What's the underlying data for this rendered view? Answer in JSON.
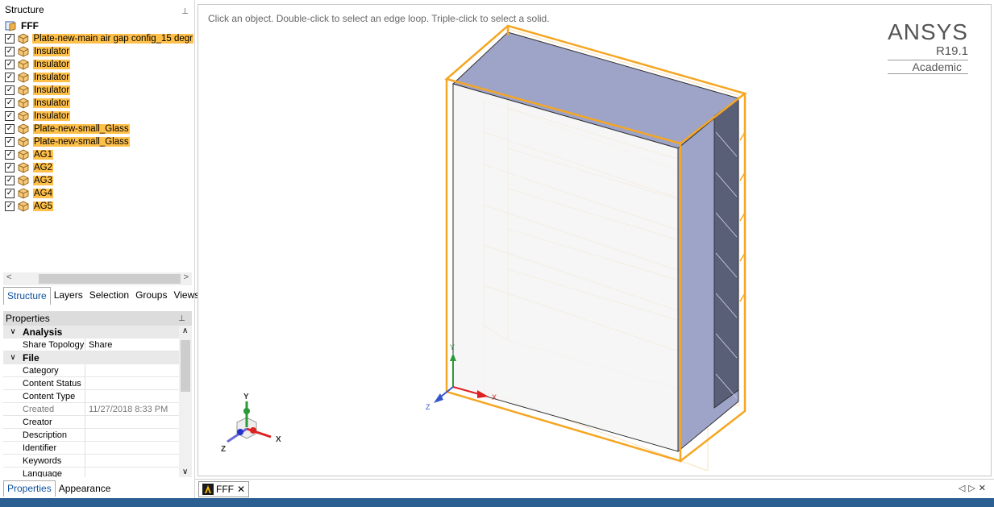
{
  "structure_panel": {
    "title": "Structure",
    "root": "FFF",
    "items": [
      {
        "label": "Plate-new-main air gap config_15 degr",
        "checked": true
      },
      {
        "label": "Insulator",
        "checked": true
      },
      {
        "label": "Insulator",
        "checked": true
      },
      {
        "label": "Insulator",
        "checked": true
      },
      {
        "label": "Insulator",
        "checked": true
      },
      {
        "label": "Insulator",
        "checked": true
      },
      {
        "label": "Insulator",
        "checked": true
      },
      {
        "label": "Plate-new-small_Glass",
        "checked": true
      },
      {
        "label": "Plate-new-small_Glass",
        "checked": true
      },
      {
        "label": "AG1",
        "checked": true
      },
      {
        "label": "AG2",
        "checked": true
      },
      {
        "label": "AG3",
        "checked": true
      },
      {
        "label": "AG4",
        "checked": true
      },
      {
        "label": "AG5",
        "checked": true
      }
    ]
  },
  "panel_tabs": [
    "Structure",
    "Layers",
    "Selection",
    "Groups",
    "Views"
  ],
  "properties": {
    "title": "Properties",
    "analysis": {
      "header": "Analysis",
      "rows": [
        {
          "key": "Share Topology",
          "value": "Share"
        }
      ]
    },
    "file": {
      "header": "File",
      "rows": [
        {
          "key": "Category",
          "value": ""
        },
        {
          "key": "Content Status",
          "value": ""
        },
        {
          "key": "Content Type",
          "value": ""
        },
        {
          "key": "Created",
          "value": "11/27/2018 8:33 PM"
        },
        {
          "key": "Creator",
          "value": ""
        },
        {
          "key": "Description",
          "value": ""
        },
        {
          "key": "Identifier",
          "value": ""
        },
        {
          "key": "Keywords",
          "value": ""
        },
        {
          "key": "Language",
          "value": ""
        }
      ]
    }
  },
  "bottom_tabs": [
    "Properties",
    "Appearance"
  ],
  "viewport": {
    "hint": "Click an object. Double-click to select an edge loop. Triple-click to select a solid.",
    "brand": "ANSYS",
    "version": "R19.1",
    "edition": "Academic",
    "axes": {
      "x": "X",
      "y": "Y",
      "z": "Z"
    }
  },
  "document_tab": {
    "label": "FFF",
    "close": "✕"
  },
  "colors": {
    "highlight": "#ffc04a",
    "selection_outline": "#f5a623",
    "status_bar": "#2b5e91",
    "accent": "#0b4f9c"
  }
}
